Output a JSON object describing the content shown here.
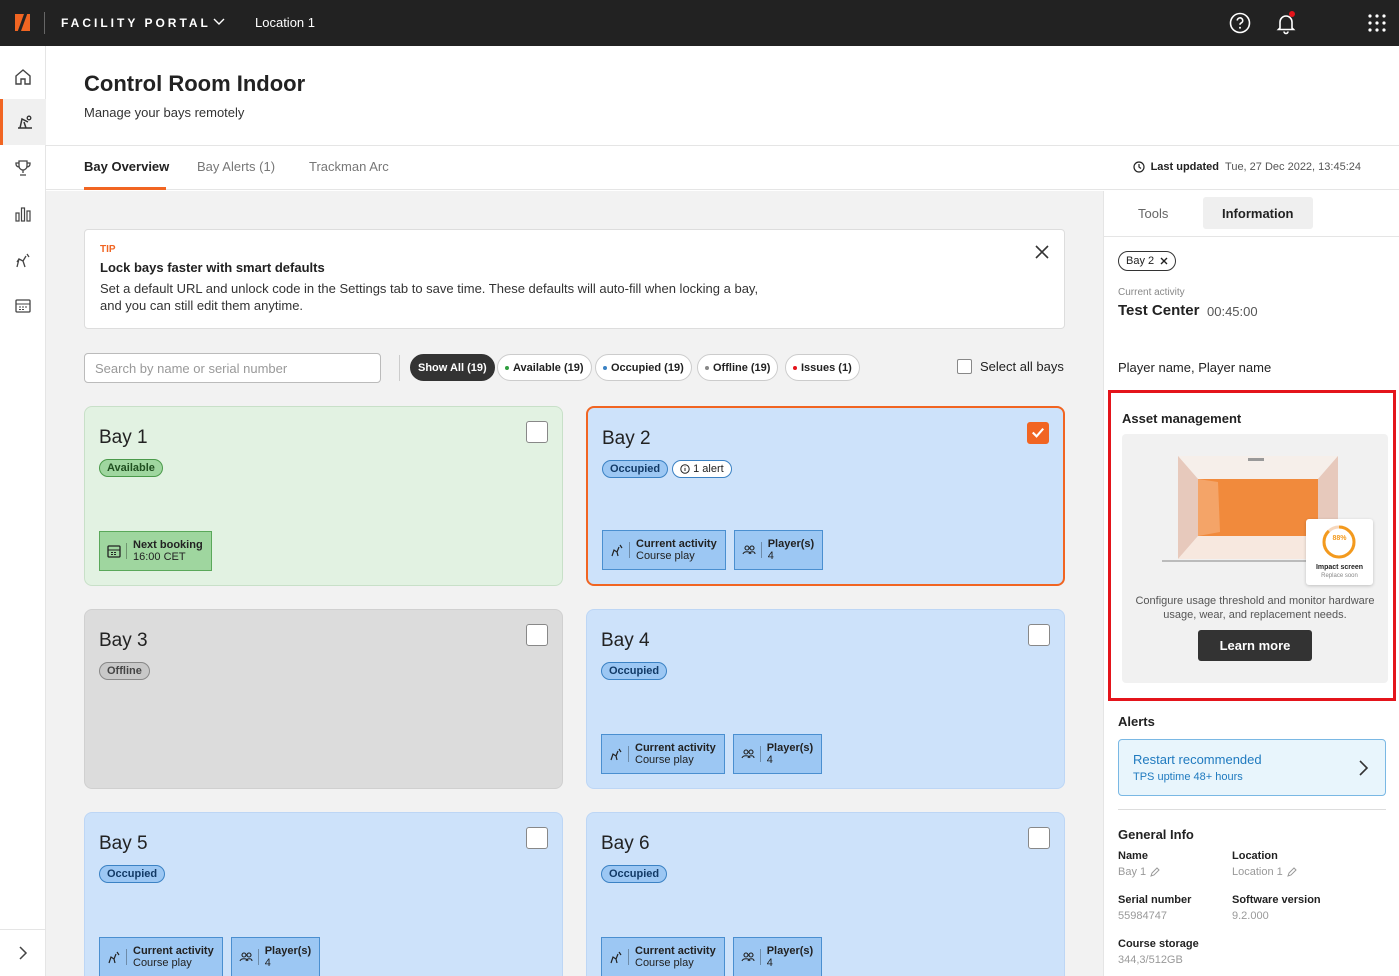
{
  "app": {
    "brand": "FACILITY PORTAL",
    "location": "Location 1"
  },
  "page": {
    "title": "Control Room Indoor",
    "subtitle": "Manage your bays remotely"
  },
  "tabs": [
    "Bay Overview",
    "Bay Alerts (1)",
    "Trackman Arc"
  ],
  "updated": {
    "label": "Last updated",
    "value": "Tue, 27 Dec 2022, 13:45:24"
  },
  "tip": {
    "kicker": "TIP",
    "title": "Lock bays faster with smart defaults",
    "body": "Set a default URL and unlock code in the Settings tab to save time. These defaults will auto-fill when locking a bay, and you can still edit them anytime."
  },
  "search": {
    "placeholder": "Search by name or serial number"
  },
  "filters": [
    "Show All (19)",
    "Available (19)",
    "Occupied (19)",
    "Offline (19)",
    "Issues (1)"
  ],
  "filter_colors": {
    "available": "#2e9e3e",
    "occupied": "#3b82c4",
    "offline": "#888888",
    "issues": "#e4141b"
  },
  "select_all": "Select all bays",
  "bays": [
    {
      "name": "Bay 1",
      "status": "Available",
      "tile1_title": "Next booking",
      "tile1_value": "16:00 CET"
    },
    {
      "name": "Bay 2",
      "status": "Occupied",
      "alert": "1 alert",
      "tile1_title": "Current activity",
      "tile1_value": "Course play",
      "tile2_title": "Player(s)",
      "tile2_value": "4",
      "selected": true
    },
    {
      "name": "Bay 3",
      "status": "Offline"
    },
    {
      "name": "Bay 4",
      "status": "Occupied",
      "tile1_title": "Current activity",
      "tile1_value": "Course play",
      "tile2_title": "Player(s)",
      "tile2_value": "4"
    },
    {
      "name": "Bay 5",
      "status": "Occupied",
      "tile1_title": "Current activity",
      "tile1_value": "Course play",
      "tile2_title": "Player(s)",
      "tile2_value": "4"
    },
    {
      "name": "Bay 6",
      "status": "Occupied",
      "tile1_title": "Current activity",
      "tile1_value": "Course play",
      "tile2_title": "Player(s)",
      "tile2_value": "4"
    }
  ],
  "panel": {
    "tabs": [
      "Tools",
      "Information"
    ],
    "bay_chip": "Bay 2",
    "current_activity_label": "Current activity",
    "current_activity": "Test Center",
    "current_time": "00:45:00",
    "players": "Player name, Player name",
    "asset": {
      "title": "Asset management",
      "gauge_value": "88%",
      "gauge_fraction": 0.88,
      "gauge_label": "Impact screen",
      "gauge_sub": "Replace soon",
      "description": "Configure usage threshold and monitor hardware usage, wear, and replacement needs.",
      "button": "Learn more"
    },
    "alerts_title": "Alerts",
    "alert": {
      "title": "Restart recommended",
      "sub": "TPS uptime 48+ hours"
    },
    "general_title": "General Info",
    "general": {
      "name_label": "Name",
      "name_value": "Bay 1",
      "location_label": "Location",
      "location_value": "Location 1",
      "serial_label": "Serial number",
      "serial_value": "55984747",
      "software_label": "Software version",
      "software_value": "9.2.000",
      "storage_label": "Course storage",
      "storage_value": "344,3/512GB"
    }
  },
  "colors": {
    "accent": "#f16522",
    "topbar": "#222222",
    "highlight": "#e4141b"
  }
}
